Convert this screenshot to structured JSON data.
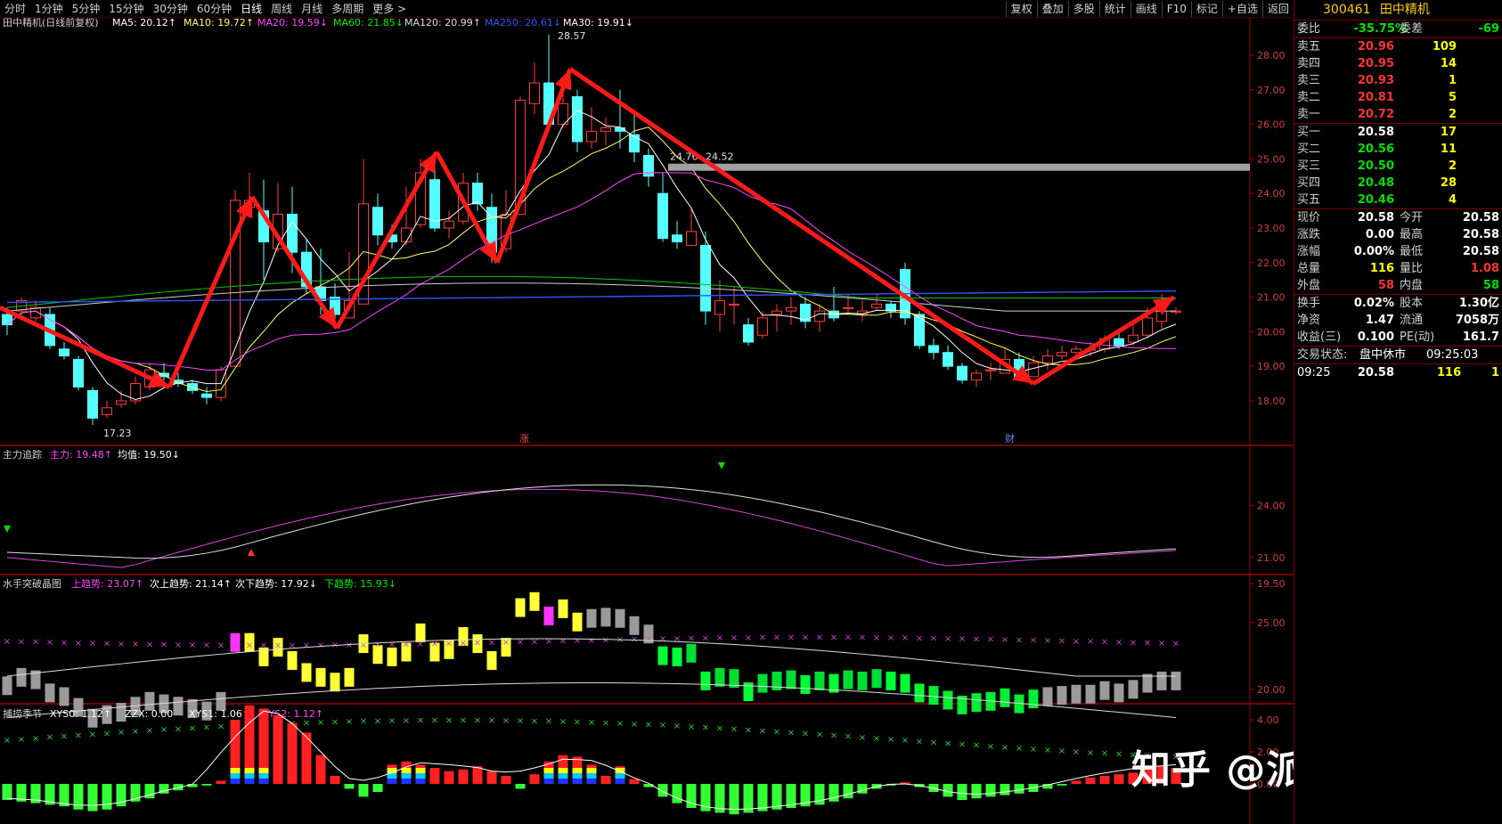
{
  "topbar": {
    "left_items": [
      "分时",
      "1分钟",
      "5分钟",
      "15分钟",
      "30分钟",
      "60分钟",
      "日线",
      "周线",
      "月线",
      "多周期",
      "更多 >"
    ],
    "active": "日线",
    "right_items": [
      "复权",
      "叠加",
      "多股",
      "统计",
      "画线",
      "F10",
      "标记",
      "+自选",
      "返回"
    ]
  },
  "main_chart": {
    "title": "田中精机(日线前复权)",
    "ma_labels": [
      {
        "text": "MA5: 20.12↑",
        "color": "#ffffff"
      },
      {
        "text": "MA10: 19.72↑",
        "color": "#ffff66"
      },
      {
        "text": "MA20: 19.59↓",
        "color": "#ff44ff"
      },
      {
        "text": "MA60: 21.85↓",
        "color": "#00ee00"
      },
      {
        "text": "MA120: 20.99↑",
        "color": "#dddddd"
      },
      {
        "text": "MA250: 20.61↓",
        "color": "#3355ff"
      },
      {
        "text": "MA30: 19.91↓",
        "color": "#ffffff"
      }
    ],
    "y_ticks": [
      "28.00",
      "27.00",
      "26.00",
      "25.00",
      "24.00",
      "23.00",
      "22.00",
      "21.00",
      "20.00",
      "19.00",
      "18.00"
    ],
    "annotations": {
      "high": "28.57",
      "low": "17.23",
      "level_left": "24.76",
      "level_right": "24.52",
      "marker_zhang": "涨",
      "marker_cai": "财"
    }
  },
  "panel2": {
    "title": "主力追踪",
    "labels": [
      {
        "text": "主力: 19.48↑",
        "color": "#ff44ff"
      },
      {
        "text": "均值: 19.50↓",
        "color": "#ffffff"
      }
    ],
    "y_ticks": [
      "24.00",
      "21.00",
      "19.50"
    ]
  },
  "panel3": {
    "title": "水手突破晶图",
    "labels": [
      {
        "text": "上趋势: 23.07↑",
        "color": "#ff44ff"
      },
      {
        "text": "次上趋势: 21.14↑",
        "color": "#ffffff"
      },
      {
        "text": "次下趋势: 17.92↓",
        "color": "#ffffff"
      },
      {
        "text": "下趋势: 15.93↓",
        "color": "#00ee00"
      }
    ],
    "y_ticks": [
      "25.00",
      "20.00"
    ]
  },
  "panel4": {
    "title": "捕捞季节",
    "labels": [
      {
        "text": "XYS0: 1.12↑",
        "color": "#ffffff"
      },
      {
        "text": "ZZX: 0.00",
        "color": "#ffffff"
      },
      {
        "text": "XYS1: 1.06↑",
        "color": "#ffffff"
      },
      {
        "text": "XYS2: 1.12↑",
        "color": "#ff44ff"
      }
    ],
    "y_ticks": [
      "4.00",
      "2.00",
      "0.00"
    ]
  },
  "watermark": "知乎 @派大的星",
  "quote": {
    "code": "300461",
    "name": "田中精机",
    "weibi_label": "委比",
    "weibi_value": "-35.75%",
    "weicha_label": "委差",
    "weicha_value": "-69",
    "asks": [
      {
        "label": "卖五",
        "price": "20.96",
        "vol": "109"
      },
      {
        "label": "卖四",
        "price": "20.95",
        "vol": "14"
      },
      {
        "label": "卖三",
        "price": "20.93",
        "vol": "1"
      },
      {
        "label": "卖二",
        "price": "20.81",
        "vol": "5"
      },
      {
        "label": "卖一",
        "price": "20.72",
        "vol": "2"
      }
    ],
    "bids": [
      {
        "label": "买一",
        "price": "20.58",
        "vol": "17"
      },
      {
        "label": "买二",
        "price": "20.56",
        "vol": "11"
      },
      {
        "label": "买三",
        "price": "20.50",
        "vol": "2"
      },
      {
        "label": "买四",
        "price": "20.48",
        "vol": "28"
      },
      {
        "label": "买五",
        "price": "20.46",
        "vol": "4"
      }
    ],
    "stats1": [
      {
        "l1": "现价",
        "v1": "20.58",
        "c1": "white",
        "l2": "今开",
        "v2": "20.58",
        "c2": "white"
      },
      {
        "l1": "涨跌",
        "v1": "0.00",
        "c1": "white",
        "l2": "最高",
        "v2": "20.58",
        "c2": "white"
      },
      {
        "l1": "涨幅",
        "v1": "0.00%",
        "c1": "white",
        "l2": "最低",
        "v2": "20.58",
        "c2": "white"
      },
      {
        "l1": "总量",
        "v1": "116",
        "c1": "yellow",
        "l2": "量比",
        "v2": "1.08",
        "c2": "red"
      },
      {
        "l1": "外盘",
        "v1": "58",
        "c1": "red",
        "l2": "内盘",
        "v2": "58",
        "c2": "green"
      }
    ],
    "stats2": [
      {
        "l1": "换手",
        "v1": "0.02%",
        "c1": "white",
        "l2": "股本",
        "v2": "1.30亿",
        "c2": "white"
      },
      {
        "l1": "净资",
        "v1": "1.47",
        "c1": "white",
        "l2": "流通",
        "v2": "7058万",
        "c2": "white"
      },
      {
        "l1": "收益(三)",
        "v1": "0.100",
        "c1": "white",
        "l2": "PE(动)",
        "v2": "161.7",
        "c2": "white"
      }
    ],
    "status_label": "交易状态:",
    "status_value": "盘中休市",
    "status_time": "09:25:03",
    "tick": {
      "time": "09:25",
      "price": "20.58",
      "vol": "116",
      "extra": "1"
    }
  }
}
